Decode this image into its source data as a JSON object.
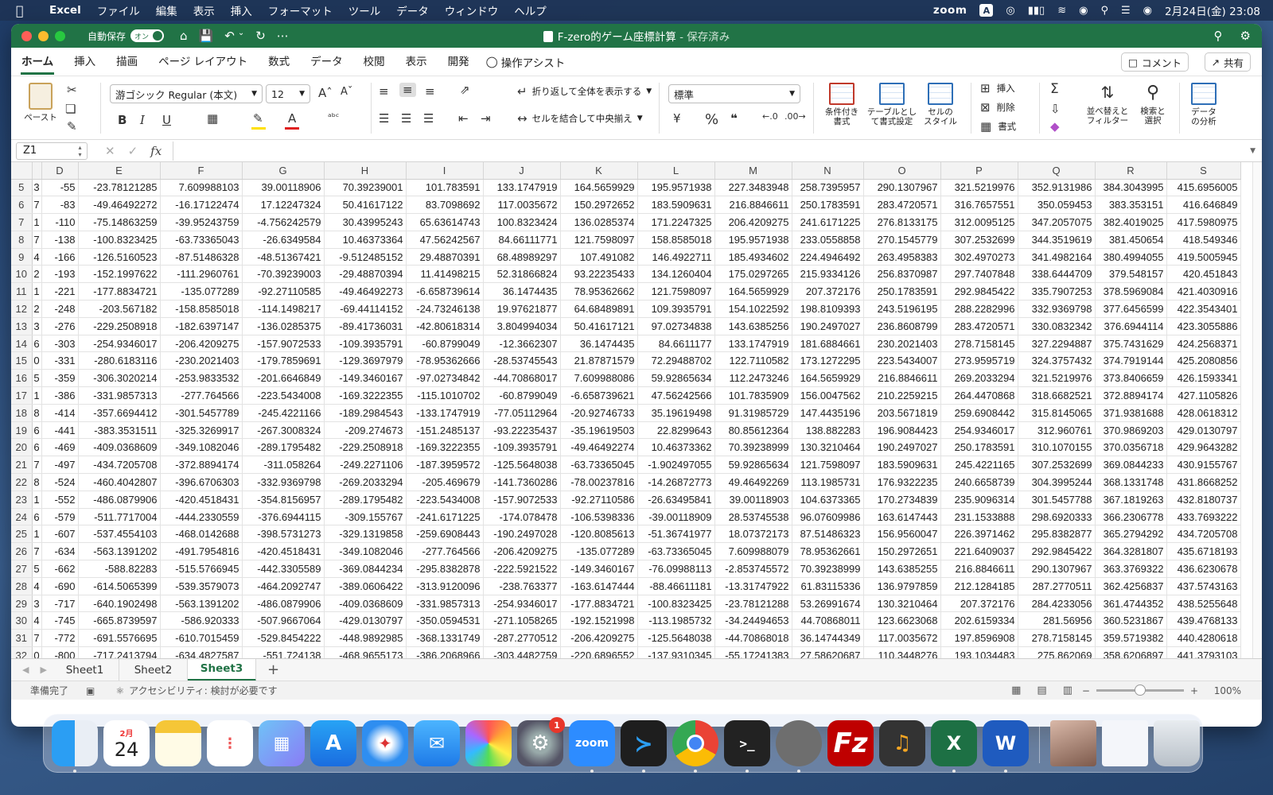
{
  "menubar": {
    "app_name": "Excel",
    "items": [
      "ファイル",
      "編集",
      "表示",
      "挿入",
      "フォーマット",
      "ツール",
      "データ",
      "ウィンドウ",
      "ヘルプ"
    ],
    "zoom_label": "zoom",
    "input_indicator": "A",
    "datetime": "2月24日(金) 23:08"
  },
  "titlebar": {
    "autosave_label": "自動保存",
    "autosave_state": "オン",
    "doc_title": "F-zero的ゲーム座標計算",
    "save_status": "- 保存済み"
  },
  "ribbon_tabs": {
    "tabs": [
      "ホーム",
      "挿入",
      "描画",
      "ページ レイアウト",
      "数式",
      "データ",
      "校閲",
      "表示",
      "開発"
    ],
    "tell_me": "操作アシスト",
    "comment_button": "コメント",
    "share_button": "共有"
  },
  "ribbon": {
    "paste_label": "ペースト",
    "font_name": "游ゴシック Regular (本文)",
    "font_size": "12",
    "wrap_text": "折り返して全体を表示する",
    "merge_center": "セルを結合して中央揃え",
    "number_format": "標準",
    "conditional_format": "条件付き\n書式",
    "format_as_table": "テーブルとして書式設定",
    "cell_styles": "セルの\nスタイル",
    "insert": "挿入",
    "delete": "削除",
    "format": "書式",
    "sort_filter": "並べ替えと\nフィルター",
    "find_select": "検索と\n選択",
    "analyze_data": "データ\nの分析",
    "colors": {
      "accent": "#217346",
      "font_color_bar": "#e02020",
      "fill_bar": "#ffe000"
    }
  },
  "formula_bar": {
    "name_box": "Z1",
    "fx": "fx",
    "formula": ""
  },
  "grid": {
    "columns": [
      "D",
      "E",
      "F",
      "G",
      "H",
      "I",
      "J",
      "K",
      "L",
      "M",
      "N",
      "O",
      "P",
      "Q",
      "R",
      "S"
    ],
    "rows": [
      {
        "n": "5",
        "c": [
          "3",
          "-55",
          "-23.78121285",
          "7.609988103",
          "39.00118906",
          "70.39239001",
          "101.783591",
          "133.1747919",
          "164.5659929",
          "195.9571938",
          "227.3483948",
          "258.7395957",
          "290.1307967",
          "321.5219976",
          "352.9131986",
          "384.3043995",
          "415.6956005"
        ]
      },
      {
        "n": "6",
        "c": [
          "7",
          "-83",
          "-49.46492272",
          "-16.17122474",
          "17.12247324",
          "50.41617122",
          "83.7098692",
          "117.0035672",
          "150.2972652",
          "183.5909631",
          "216.8846611",
          "250.1783591",
          "283.4720571",
          "316.7657551",
          "350.059453",
          "383.353151",
          "416.646849"
        ]
      },
      {
        "n": "7",
        "c": [
          "1",
          "-110",
          "-75.14863259",
          "-39.95243759",
          "-4.756242579",
          "30.43995243",
          "65.63614743",
          "100.8323424",
          "136.0285374",
          "171.2247325",
          "206.4209275",
          "241.6171225",
          "276.8133175",
          "312.0095125",
          "347.2057075",
          "382.4019025",
          "417.5980975"
        ]
      },
      {
        "n": "8",
        "c": [
          "7",
          "-138",
          "-100.8323425",
          "-63.73365043",
          "-26.6349584",
          "10.46373364",
          "47.56242567",
          "84.66111771",
          "121.7598097",
          "158.8585018",
          "195.9571938",
          "233.0558858",
          "270.1545779",
          "307.2532699",
          "344.3519619",
          "381.450654",
          "418.549346"
        ]
      },
      {
        "n": "9",
        "c": [
          "4",
          "-166",
          "-126.5160523",
          "-87.51486328",
          "-48.51367421",
          "-9.512485152",
          "29.48870391",
          "68.48989297",
          "107.491082",
          "146.4922711",
          "185.4934602",
          "224.4946492",
          "263.4958383",
          "302.4970273",
          "341.4982164",
          "380.4994055",
          "419.5005945"
        ]
      },
      {
        "n": "10",
        "c": [
          "2",
          "-193",
          "-152.1997622",
          "-111.2960761",
          "-70.39239003",
          "-29.48870394",
          "11.41498215",
          "52.31866824",
          "93.22235433",
          "134.1260404",
          "175.0297265",
          "215.9334126",
          "256.8370987",
          "297.7407848",
          "338.6444709",
          "379.548157",
          "420.451843"
        ]
      },
      {
        "n": "11",
        "c": [
          "1",
          "-221",
          "-177.8834721",
          "-135.077289",
          "-92.27110585",
          "-49.46492273",
          "-6.658739614",
          "36.1474435",
          "78.95362662",
          "121.7598097",
          "164.5659929",
          "207.372176",
          "250.1783591",
          "292.9845422",
          "335.7907253",
          "378.5969084",
          "421.4030916"
        ]
      },
      {
        "n": "12",
        "c": [
          "2",
          "-248",
          "-203.567182",
          "-158.8585018",
          "-114.1498217",
          "-69.44114152",
          "-24.73246138",
          "19.97621877",
          "64.68489891",
          "109.3935791",
          "154.1022592",
          "198.8109393",
          "243.5196195",
          "288.2282996",
          "332.9369798",
          "377.6456599",
          "422.3543401"
        ]
      },
      {
        "n": "13",
        "c": [
          "3",
          "-276",
          "-229.2508918",
          "-182.6397147",
          "-136.0285375",
          "-89.41736031",
          "-42.80618314",
          "3.804994034",
          "50.41617121",
          "97.02734838",
          "143.6385256",
          "190.2497027",
          "236.8608799",
          "283.4720571",
          "330.0832342",
          "376.6944114",
          "423.3055886"
        ]
      },
      {
        "n": "14",
        "c": [
          "6",
          "-303",
          "-254.9346017",
          "-206.4209275",
          "-157.9072533",
          "-109.3935791",
          "-60.8799049",
          "-12.3662307",
          "36.1474435",
          "84.6611177",
          "133.1747919",
          "181.6884661",
          "230.2021403",
          "278.7158145",
          "327.2294887",
          "375.7431629",
          "424.2568371"
        ]
      },
      {
        "n": "15",
        "c": [
          "0",
          "-331",
          "-280.6183116",
          "-230.2021403",
          "-179.7859691",
          "-129.3697979",
          "-78.95362666",
          "-28.53745543",
          "21.87871579",
          "72.29488702",
          "122.7110582",
          "173.1272295",
          "223.5434007",
          "273.9595719",
          "324.3757432",
          "374.7919144",
          "425.2080856"
        ]
      },
      {
        "n": "16",
        "c": [
          "5",
          "-359",
          "-306.3020214",
          "-253.9833532",
          "-201.6646849",
          "-149.3460167",
          "-97.02734842",
          "-44.70868017",
          "7.609988086",
          "59.92865634",
          "112.2473246",
          "164.5659929",
          "216.8846611",
          "269.2033294",
          "321.5219976",
          "373.8406659",
          "426.1593341"
        ]
      },
      {
        "n": "17",
        "c": [
          "1",
          "-386",
          "-331.9857313",
          "-277.764566",
          "-223.5434008",
          "-169.3222355",
          "-115.1010702",
          "-60.8799049",
          "-6.658739621",
          "47.56242566",
          "101.7835909",
          "156.0047562",
          "210.2259215",
          "264.4470868",
          "318.6682521",
          "372.8894174",
          "427.1105826"
        ]
      },
      {
        "n": "18",
        "c": [
          "8",
          "-414",
          "-357.6694412",
          "-301.5457789",
          "-245.4221166",
          "-189.2984543",
          "-133.1747919",
          "-77.05112964",
          "-20.92746733",
          "35.19619498",
          "91.31985729",
          "147.4435196",
          "203.5671819",
          "259.6908442",
          "315.8145065",
          "371.9381688",
          "428.0618312"
        ]
      },
      {
        "n": "19",
        "c": [
          "6",
          "-441",
          "-383.3531511",
          "-325.3269917",
          "-267.3008324",
          "-209.274673",
          "-151.2485137",
          "-93.22235437",
          "-35.19619503",
          "22.8299643",
          "80.85612364",
          "138.882283",
          "196.9084423",
          "254.9346017",
          "312.960761",
          "370.9869203",
          "429.0130797"
        ]
      },
      {
        "n": "20",
        "c": [
          "6",
          "-469",
          "-409.0368609",
          "-349.1082046",
          "-289.1795482",
          "-229.2508918",
          "-169.3222355",
          "-109.3935791",
          "-49.46492274",
          "10.46373362",
          "70.39238999",
          "130.3210464",
          "190.2497027",
          "250.1783591",
          "310.1070155",
          "370.0356718",
          "429.9643282"
        ]
      },
      {
        "n": "21",
        "c": [
          "7",
          "-497",
          "-434.7205708",
          "-372.8894174",
          "-311.058264",
          "-249.2271106",
          "-187.3959572",
          "-125.5648038",
          "-63.73365045",
          "-1.902497055",
          "59.92865634",
          "121.7598097",
          "183.5909631",
          "245.4221165",
          "307.2532699",
          "369.0844233",
          "430.9155767"
        ]
      },
      {
        "n": "22",
        "c": [
          "8",
          "-524",
          "-460.4042807",
          "-396.6706303",
          "-332.9369798",
          "-269.2033294",
          "-205.469679",
          "-141.7360286",
          "-78.00237816",
          "-14.26872773",
          "49.46492269",
          "113.1985731",
          "176.9322235",
          "240.6658739",
          "304.3995244",
          "368.1331748",
          "431.8668252"
        ]
      },
      {
        "n": "23",
        "c": [
          "1",
          "-552",
          "-486.0879906",
          "-420.4518431",
          "-354.8156957",
          "-289.1795482",
          "-223.5434008",
          "-157.9072533",
          "-92.27110586",
          "-26.63495841",
          "39.00118903",
          "104.6373365",
          "170.2734839",
          "235.9096314",
          "301.5457788",
          "367.1819263",
          "432.8180737"
        ]
      },
      {
        "n": "24",
        "c": [
          "6",
          "-579",
          "-511.7717004",
          "-444.2330559",
          "-376.6944115",
          "-309.155767",
          "-241.6171225",
          "-174.078478",
          "-106.5398336",
          "-39.00118909",
          "28.53745538",
          "96.07609986",
          "163.6147443",
          "231.1533888",
          "298.6920333",
          "366.2306778",
          "433.7693222"
        ]
      },
      {
        "n": "25",
        "c": [
          "1",
          "-607",
          "-537.4554103",
          "-468.0142688",
          "-398.5731273",
          "-329.1319858",
          "-259.6908443",
          "-190.2497028",
          "-120.8085613",
          "-51.36741977",
          "18.07372173",
          "87.51486323",
          "156.9560047",
          "226.3971462",
          "295.8382877",
          "365.2794292",
          "434.7205708"
        ]
      },
      {
        "n": "26",
        "c": [
          "7",
          "-634",
          "-563.1391202",
          "-491.7954816",
          "-420.4518431",
          "-349.1082046",
          "-277.764566",
          "-206.4209275",
          "-135.077289",
          "-63.73365045",
          "7.609988079",
          "78.95362661",
          "150.2972651",
          "221.6409037",
          "292.9845422",
          "364.3281807",
          "435.6718193"
        ]
      },
      {
        "n": "27",
        "c": [
          "5",
          "-662",
          "-588.82283",
          "-515.5766945",
          "-442.3305589",
          "-369.0844234",
          "-295.8382878",
          "-222.5921522",
          "-149.3460167",
          "-76.09988113",
          "-2.853745572",
          "70.39238999",
          "143.6385255",
          "216.8846611",
          "290.1307967",
          "363.3769322",
          "436.6230678"
        ]
      },
      {
        "n": "28",
        "c": [
          "4",
          "-690",
          "-614.5065399",
          "-539.3579073",
          "-464.2092747",
          "-389.0606422",
          "-313.9120096",
          "-238.763377",
          "-163.6147444",
          "-88.46611181",
          "-13.31747922",
          "61.83115336",
          "136.9797859",
          "212.1284185",
          "287.2770511",
          "362.4256837",
          "437.5743163"
        ]
      },
      {
        "n": "29",
        "c": [
          "3",
          "-717",
          "-640.1902498",
          "-563.1391202",
          "-486.0879906",
          "-409.0368609",
          "-331.9857313",
          "-254.9346017",
          "-177.8834721",
          "-100.8323425",
          "-23.78121288",
          "53.26991674",
          "130.3210464",
          "207.372176",
          "284.4233056",
          "361.4744352",
          "438.5255648"
        ]
      },
      {
        "n": "30",
        "c": [
          "4",
          "-745",
          "-665.8739597",
          "-586.920333",
          "-507.9667064",
          "-429.0130797",
          "-350.0594531",
          "-271.1058265",
          "-192.1521998",
          "-113.1985732",
          "-34.24494653",
          "44.70868011",
          "123.6623068",
          "202.6159334",
          "281.56956",
          "360.5231867",
          "439.4768133"
        ]
      },
      {
        "n": "31",
        "c": [
          "7",
          "-772",
          "-691.5576695",
          "-610.7015459",
          "-529.8454222",
          "-448.9892985",
          "-368.1331749",
          "-287.2770512",
          "-206.4209275",
          "-125.5648038",
          "-44.70868018",
          "36.14744349",
          "117.0035672",
          "197.8596908",
          "278.7158145",
          "359.5719382",
          "440.4280618"
        ]
      },
      {
        "n": "32",
        "c": [
          "0",
          "-800",
          "-717.2413794",
          "-634.4827587",
          "-551.724138",
          "-468.9655173",
          "-386.2068966",
          "-303.4482759",
          "-220.6896552",
          "-137.9310345",
          "-55.17241383",
          "27.58620687",
          "110.3448276",
          "193.1034483",
          "275.862069",
          "358.6206897",
          "441.3793103"
        ]
      }
    ]
  },
  "sheet_tabs": {
    "sheets": [
      "Sheet1",
      "Sheet2",
      "Sheet3"
    ],
    "active": "Sheet3",
    "add": "+"
  },
  "status_bar": {
    "ready": "準備完了",
    "accessibility": "アクセシビリティ: 検討が必要です",
    "zoom": "100%"
  },
  "dock": {
    "calendar_month": "2月",
    "calendar_day": "24",
    "settings_badge": "1",
    "zoom_label": "zoom"
  }
}
